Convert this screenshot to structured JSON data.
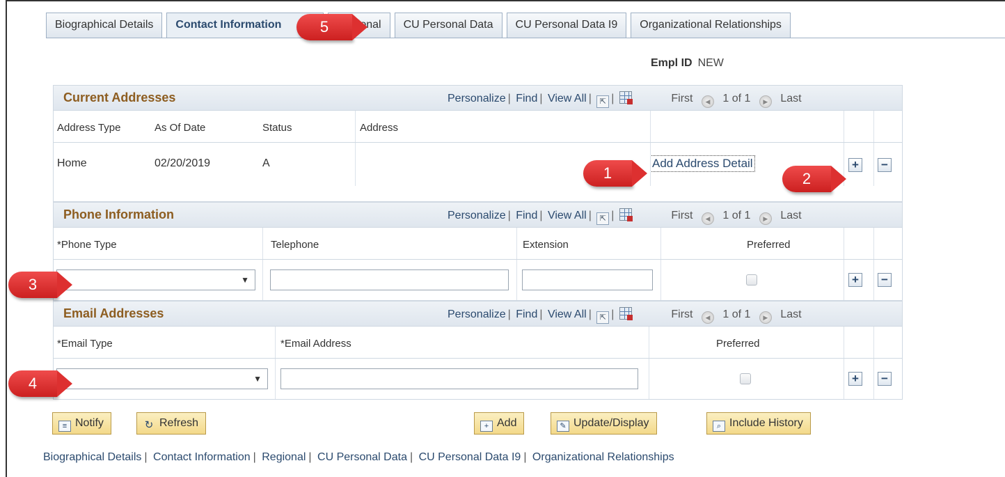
{
  "tabs": [
    {
      "label": "Biographical Details"
    },
    {
      "label": "Contact Information"
    },
    {
      "label": "Regional"
    },
    {
      "label": "CU Personal Data"
    },
    {
      "label": "CU Personal Data I9"
    },
    {
      "label": "Organizational Relationships"
    }
  ],
  "empl": {
    "label": "Empl ID",
    "value": "NEW"
  },
  "grid_nav": {
    "personalize": "Personalize",
    "find": "Find",
    "view_all": "View All",
    "first": "First",
    "count": "1 of 1",
    "last": "Last"
  },
  "addresses": {
    "title": "Current Addresses",
    "columns": [
      "Address Type",
      "As Of Date",
      "Status",
      "Address"
    ],
    "row": {
      "type": "Home",
      "date": "02/20/2019",
      "status": "A",
      "address": "",
      "link": "Add Address Detail"
    }
  },
  "phone": {
    "title": "Phone Information",
    "columns": [
      "*Phone Type",
      "Telephone",
      "Extension",
      "Preferred"
    ],
    "row": {
      "phone_type": "",
      "telephone": "",
      "extension": "",
      "preferred": false
    }
  },
  "email": {
    "title": "Email Addresses",
    "columns": [
      "*Email Type",
      "*Email Address",
      "Preferred"
    ],
    "row": {
      "email_type": "",
      "email_address": "",
      "preferred": false
    }
  },
  "buttons": {
    "notify": "Notify",
    "refresh": "Refresh",
    "add": "Add",
    "update": "Update/Display",
    "history": "Include History"
  },
  "footer_links": [
    "Biographical Details",
    "Contact Information",
    "Regional",
    "CU Personal Data",
    "CU Personal Data I9",
    "Organizational Relationships"
  ],
  "callouts": [
    "1",
    "2",
    "3",
    "4",
    "5"
  ],
  "row_buttons": {
    "add": "+",
    "remove": "−"
  },
  "colors": {
    "accent": "#2b4a6e",
    "grid_title": "#8d5d20",
    "callout": "#dd3030",
    "button": "#f3d98a"
  }
}
